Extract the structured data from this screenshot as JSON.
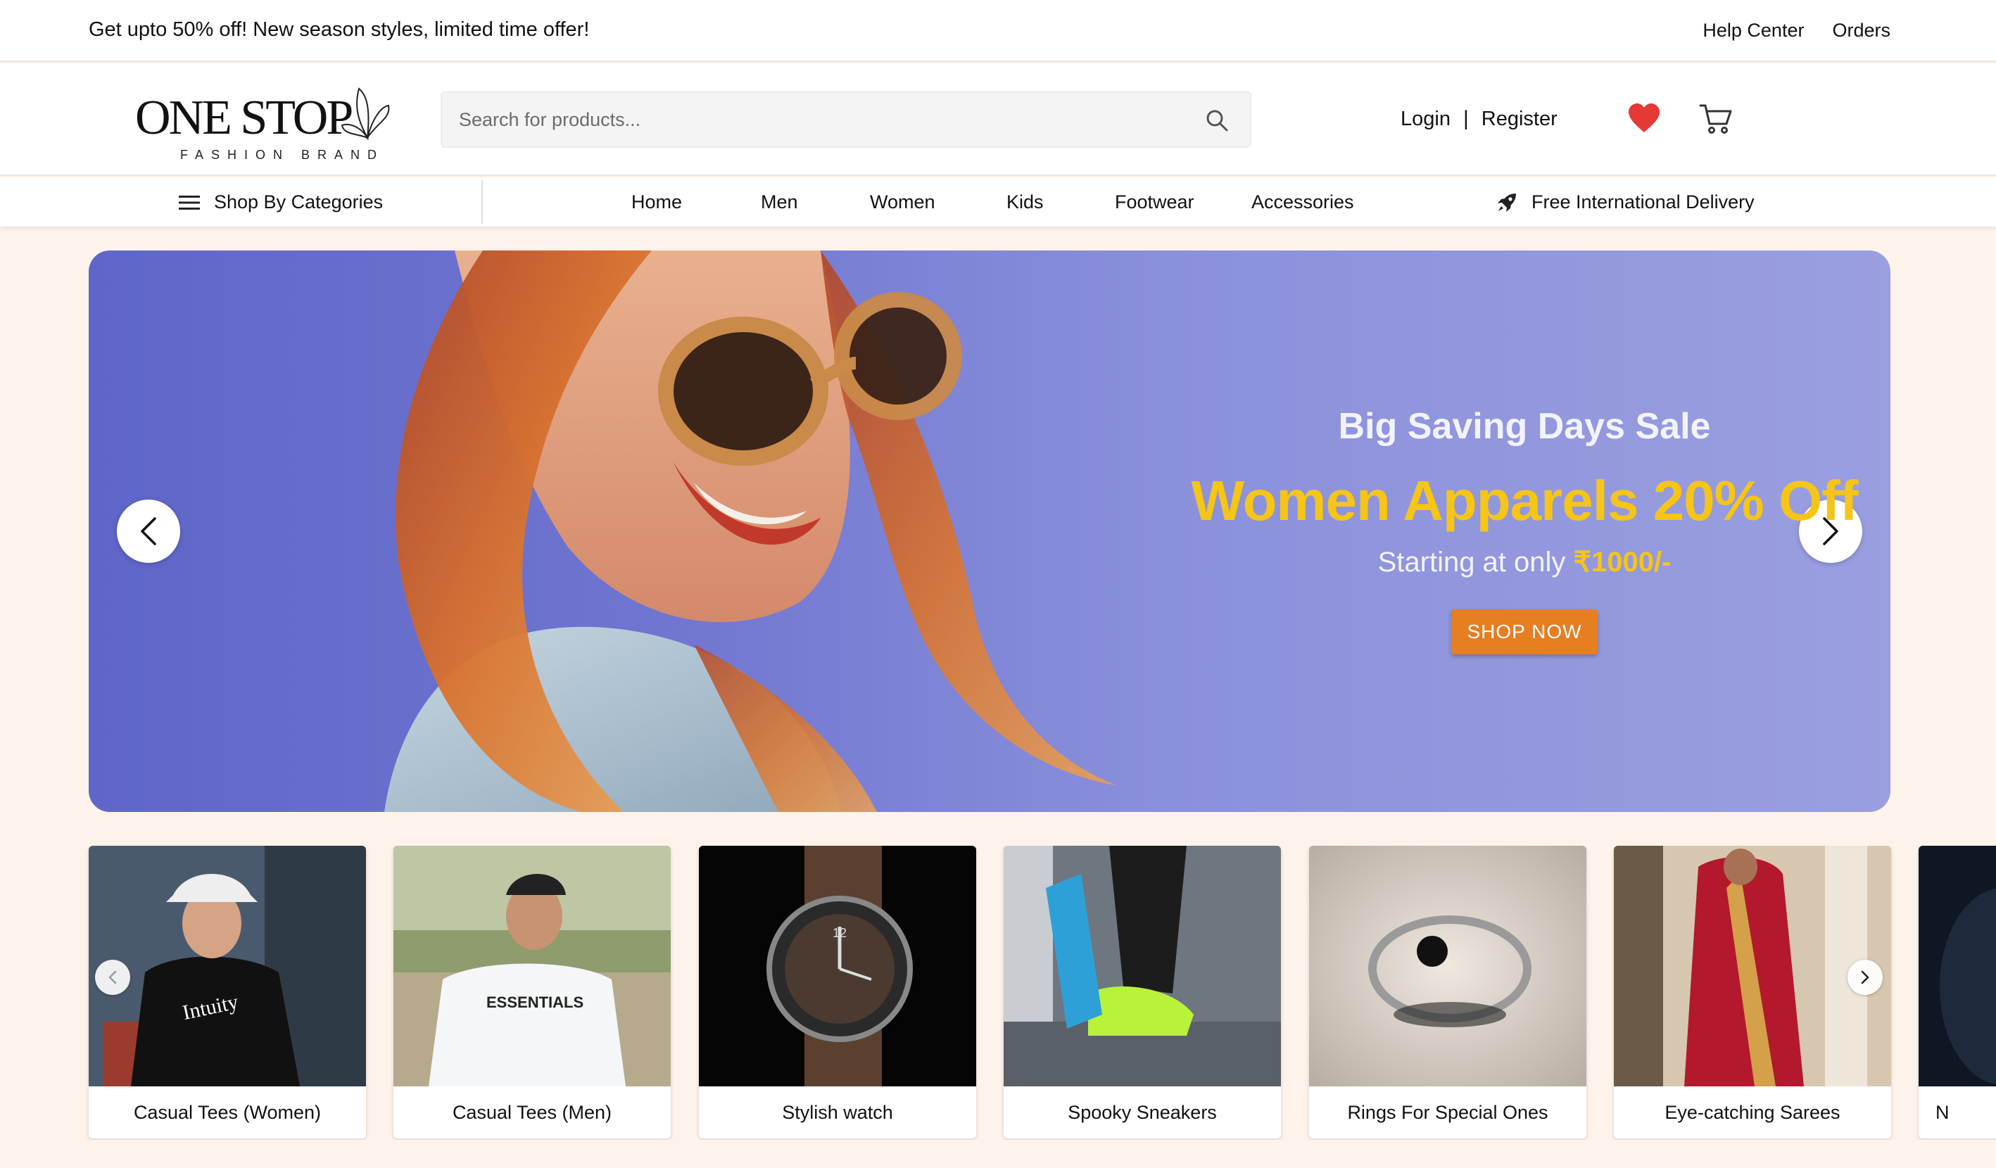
{
  "topbar": {
    "promo": "Get upto 50% off! New season styles, limited time offer!",
    "help_center": "Help Center",
    "orders": "Orders"
  },
  "header": {
    "logo_main": "ONE STOP",
    "logo_sub": "FASHION BRAND",
    "search_placeholder": "Search for products...",
    "login": "Login",
    "separator": "|",
    "register": "Register"
  },
  "nav": {
    "categories_label": "Shop By Categories",
    "items": [
      "Home",
      "Men",
      "Women",
      "Kids",
      "Footwear",
      "Accessories"
    ],
    "delivery": "Free International Delivery"
  },
  "hero": {
    "title": "Big Saving Days Sale",
    "offer": "Women Apparels 20% Off",
    "price_prefix": "Starting at only ",
    "price": "₹1000/-",
    "cta": "SHOP NOW"
  },
  "categories": [
    {
      "label": "Casual Tees (Women)"
    },
    {
      "label": "Casual Tees (Men)"
    },
    {
      "label": "Stylish watch"
    },
    {
      "label": "Spooky Sneakers"
    },
    {
      "label": "Rings For Special Ones"
    },
    {
      "label": "Eye-catching Sarees"
    },
    {
      "label": "N"
    }
  ],
  "colors": {
    "accent_orange": "#e67e22",
    "offer_yellow": "#f5c518",
    "hero_bg": "#7a80d6",
    "heart_red": "#e53935",
    "page_bg": "#fdf3ea"
  }
}
